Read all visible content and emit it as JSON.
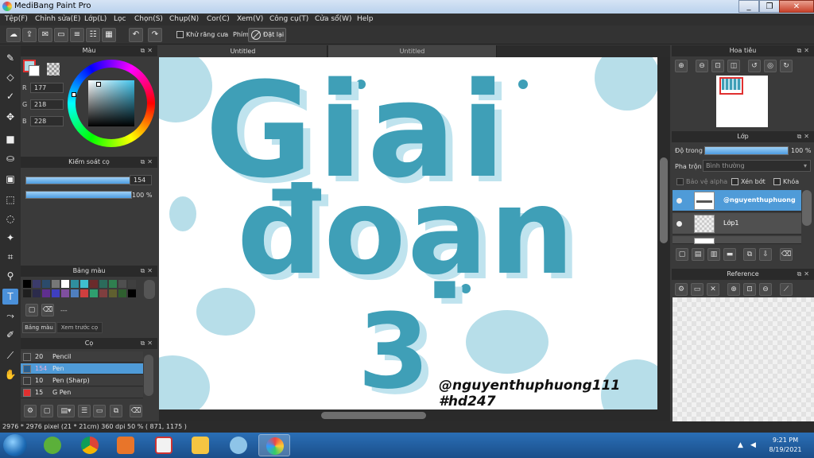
{
  "window": {
    "title": "MediBang Paint Pro",
    "controls": [
      "_",
      "❐",
      "✕"
    ]
  },
  "menu": [
    "Tệp(F)",
    "Chỉnh sửa(E)",
    "Lớp(L)",
    "Lọc",
    "Chọn(S)",
    "Chụp(N)",
    "Cor(C)",
    "Xem(V)",
    "Công cụ(T)",
    "Cửa sổ(W)",
    "Help"
  ],
  "toolbar": {
    "antialias_label": "Khử răng cưa",
    "key_label": "Phím",
    "reset_label": "Đặt lại"
  },
  "color_panel": {
    "title": "Màu",
    "r_label": "R",
    "r": "177",
    "g_label": "G",
    "g": "218",
    "b_label": "B",
    "b": "228",
    "foreground": "#b1dae4"
  },
  "brush_control": {
    "title": "Kiểm soát cọ",
    "size": "154",
    "opacity": "100 %"
  },
  "palette": {
    "title": "Bảng màu",
    "more_label": "---",
    "colors": [
      "#000000",
      "#3b3b6b",
      "#2b4b6b",
      "#777777",
      "#ffffff",
      "#2f8f9f",
      "#3fbfcf",
      "#6b2b2b",
      "#2b6b5b",
      "#2f7f4f",
      "#4f4f4f",
      "#3f3f3f",
      "#1f1f1f",
      "#2b2b4b",
      "#5f2f8f",
      "#3f3fbf",
      "#7f4f9f",
      "#4f7fbf",
      "#cf3f3f",
      "#2f9f6f",
      "#7f3f3f",
      "#5f5f2f",
      "#2f5f2f",
      "#000000"
    ]
  },
  "tabs_bottom": {
    "palette_tab": "Bảng màu",
    "preview_tab": "Xem trước cọ"
  },
  "brushes": {
    "title": "Cọ",
    "items": [
      {
        "size": "20",
        "name": "Pencil",
        "chip": "#3a3a3a",
        "selected": false
      },
      {
        "size": "154",
        "name": "Pen",
        "chip": "#2a5f8f",
        "selected": true
      },
      {
        "size": "10",
        "name": "Pen (Sharp)",
        "chip": "#3a3a3a",
        "selected": false
      },
      {
        "size": "15",
        "name": "G Pen",
        "chip": "#e03030",
        "selected": false
      }
    ]
  },
  "document_tabs": [
    "Untitled",
    "Untitled"
  ],
  "canvas": {
    "line1": "Giai",
    "line2": "đoạn",
    "line3": "3",
    "handle": "@nguyenthuphuong111",
    "hashtag": "#hd247"
  },
  "navigator": {
    "title": "Hoa tiêu"
  },
  "layers": {
    "title": "Lớp",
    "opacity_label": "Độ trong",
    "opacity_value": "100 %",
    "blend_label": "Pha trộn",
    "blend_value": "Bình thường",
    "protect_alpha": "Bảo vệ alpha",
    "clipping": "Xén bớt",
    "lock": "Khóa",
    "items": [
      {
        "name": "@nguyenthuphuong",
        "selected": true
      },
      {
        "name": "Lớp1",
        "selected": false
      }
    ]
  },
  "reference": {
    "title": "Reference"
  },
  "status": {
    "text": "2976 * 2976 pixel   (21 * 21cm)   360 dpi   50 %   ( 871, 1175 )"
  },
  "taskbar": {
    "time": "9:21 PM",
    "date": "8/19/2021"
  }
}
